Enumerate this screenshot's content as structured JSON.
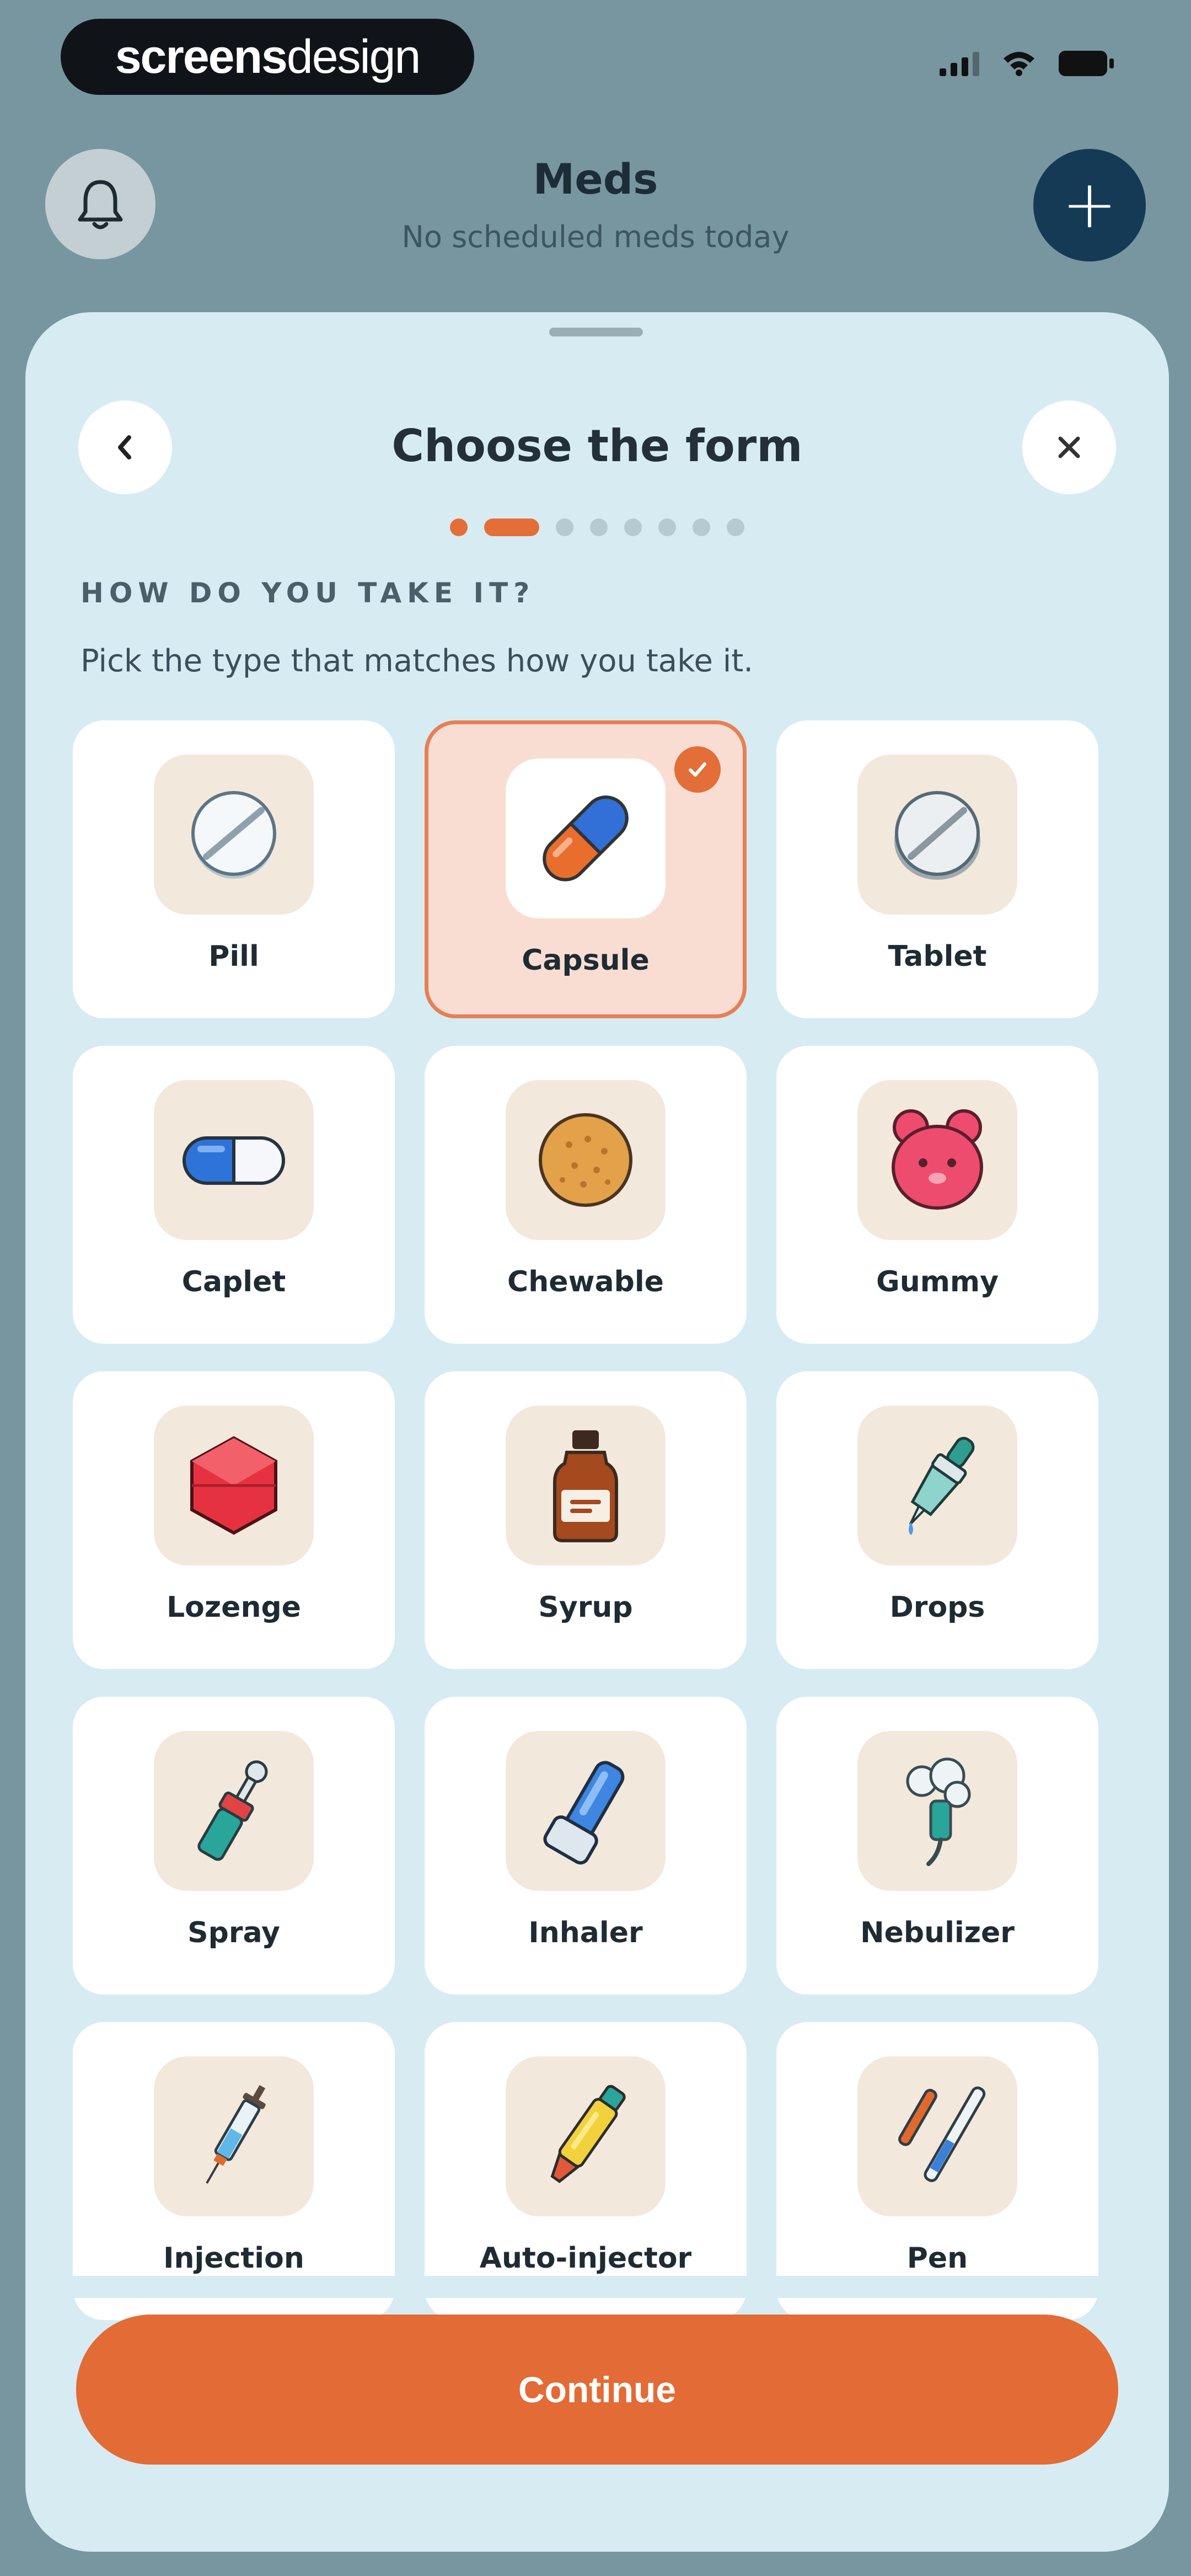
{
  "watermark": {
    "bold": "screens",
    "light": "design"
  },
  "status_bar": {
    "icons": [
      "signal-icon",
      "wifi-icon",
      "battery-icon"
    ]
  },
  "header": {
    "title": "Meds",
    "subtitle": "No scheduled meds today",
    "left_icon": "bell-icon",
    "right_icon": "plus-icon",
    "right_label": "+"
  },
  "sheet": {
    "title": "Choose the form",
    "back_icon": "chevron-left-icon",
    "close_icon": "close-icon",
    "steps": {
      "total": 8,
      "current": 2
    },
    "section_label": "HOW DO YOU TAKE IT?",
    "section_help": "Pick the type that matches how you take it.",
    "forms": [
      {
        "label": "Pill",
        "icon": "pill-icon",
        "selected": false
      },
      {
        "label": "Capsule",
        "icon": "capsule-icon",
        "selected": true
      },
      {
        "label": "Tablet",
        "icon": "tablet-icon",
        "selected": false
      },
      {
        "label": "Caplet",
        "icon": "caplet-icon",
        "selected": false
      },
      {
        "label": "Chewable",
        "icon": "chewable-icon",
        "selected": false
      },
      {
        "label": "Gummy",
        "icon": "gummy-icon",
        "selected": false
      },
      {
        "label": "Lozenge",
        "icon": "lozenge-icon",
        "selected": false
      },
      {
        "label": "Syrup",
        "icon": "syrup-icon",
        "selected": false
      },
      {
        "label": "Drops",
        "icon": "drops-icon",
        "selected": false
      },
      {
        "label": "Spray",
        "icon": "spray-icon",
        "selected": false
      },
      {
        "label": "Inhaler",
        "icon": "inhaler-icon",
        "selected": false
      },
      {
        "label": "Nebulizer",
        "icon": "nebulizer-icon",
        "selected": false
      },
      {
        "label": "Injection",
        "icon": "injection-icon",
        "selected": false
      },
      {
        "label": "Auto-injector",
        "icon": "auto-injector-icon",
        "selected": false
      },
      {
        "label": "Pen",
        "icon": "pen-icon",
        "selected": false
      }
    ],
    "continue_label": "Continue"
  },
  "colors": {
    "backdrop": "#7796a0",
    "sheet": "#d6ecf2",
    "accent": "#e36b35",
    "selected_card": "#f9ddd3",
    "icon_tile": "#f3e8dc",
    "add_button": "#153a55"
  }
}
